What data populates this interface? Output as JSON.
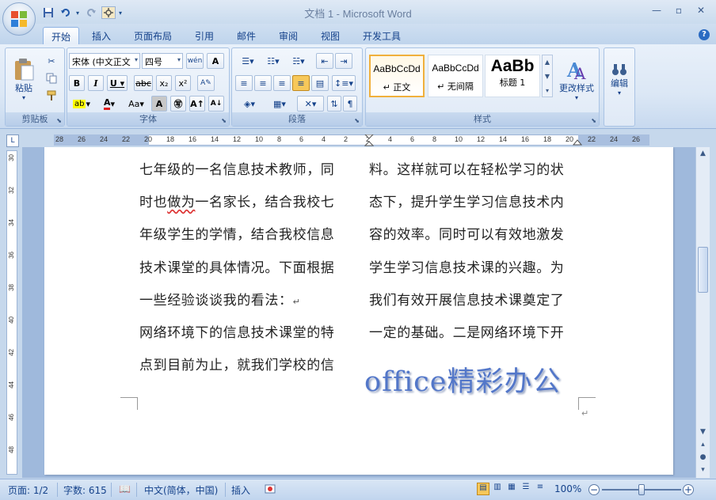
{
  "window": {
    "title": "文档 1 - Microsoft Word",
    "minimize_icon": "minimize-icon",
    "maximize_icon": "maximize-icon",
    "close_icon": "close-icon"
  },
  "quick_access": {
    "items": [
      "save-icon",
      "undo-icon",
      "redo-icon",
      "customize-icon"
    ]
  },
  "tabs": [
    {
      "label": "开始",
      "active": true
    },
    {
      "label": "插入"
    },
    {
      "label": "页面布局"
    },
    {
      "label": "引用"
    },
    {
      "label": "邮件"
    },
    {
      "label": "审阅"
    },
    {
      "label": "视图"
    },
    {
      "label": "开发工具"
    }
  ],
  "ribbon": {
    "clipboard": {
      "paste_label": "粘贴",
      "group_label": "剪贴板"
    },
    "font": {
      "font_name": "宋体 (中文正文",
      "font_size": "四号",
      "group_label": "字体"
    },
    "paragraph": {
      "group_label": "段落"
    },
    "styles": {
      "group_label": "样式",
      "items": [
        {
          "preview": "AaBbCcDd",
          "name": "↵ 正文",
          "selected": true
        },
        {
          "preview": "AaBbCcDd",
          "name": "↵ 无间隔"
        },
        {
          "preview": "AaBb",
          "name": "标题 1"
        }
      ],
      "change_styles_label": "更改样式"
    },
    "editing": {
      "label": "编辑"
    }
  },
  "ruler": {
    "ticks": [
      "28",
      "26",
      "24",
      "22",
      "20",
      "18",
      "16",
      "14",
      "12",
      "10",
      "8",
      "6",
      "4",
      "2",
      "2",
      "4",
      "6",
      "8",
      "10",
      "12",
      "14",
      "16",
      "18",
      "20",
      "22",
      "24",
      "26"
    ],
    "v_ticks": [
      "30",
      "32",
      "34",
      "36",
      "38",
      "40",
      "42",
      "44",
      "46",
      "48"
    ]
  },
  "document": {
    "col1": [
      "七年级的一名信息技术教师，同",
      "时也做为一名家长，结合我校七",
      "年级学生的学情，结合我校信息",
      "技术课堂的具体情况。下面根据",
      "一些经验谈谈我的看法：",
      "网络环境下的信息技术课堂的特",
      "点到目前为止，就我们学校的信"
    ],
    "col2": [
      "料。这样就可以在轻松学习的状",
      "态下，提升学生学习信息技术内",
      "容的效率。同时可以有效地激发",
      "学生学习信息技术课的兴趣。为",
      "我们有效开展信息技术课奠定了",
      "一定的基础。二是网络环境下开"
    ],
    "paragraph_mark": "↵",
    "watermark": "office精彩办公"
  },
  "statusbar": {
    "page": "页面: 1/2",
    "words": "字数: 615",
    "language": "中文(简体，中国)",
    "insert_mode": "插入",
    "zoom": "100%"
  }
}
